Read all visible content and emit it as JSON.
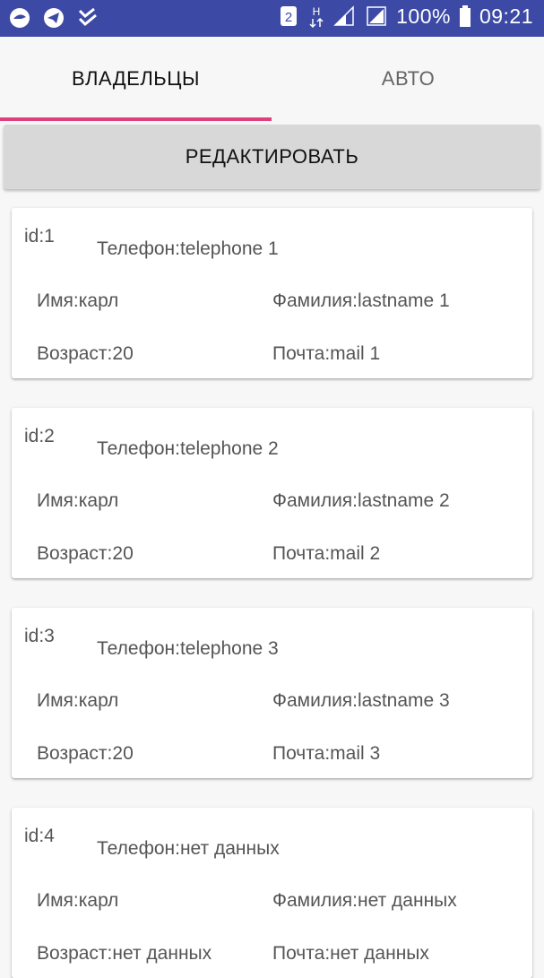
{
  "status": {
    "battery": "100%",
    "time": "09:21",
    "sim_badge": "2",
    "net_label": "H",
    "icons": [
      "app-icon",
      "telegram-icon",
      "checklist-icon",
      "sim-icon",
      "network-type-icon",
      "signal-icon",
      "signal-icon",
      "battery-icon"
    ]
  },
  "tabs": [
    {
      "label": "ВЛАДЕЛЬЦЫ",
      "active": true
    },
    {
      "label": "АВТО",
      "active": false
    }
  ],
  "accent": "#e0407a",
  "statusbar_color": "#3c4aa6",
  "edit_button": {
    "label": "РЕДАКТИРОВАТЬ"
  },
  "cards": [
    {
      "id": "id:1",
      "phone": "Телефон:telephone 1",
      "name": "Имя:карл",
      "lastname": "Фамилия:lastname 1",
      "age": "Возраст:20",
      "mail": "Почта:mail 1"
    },
    {
      "id": "id:2",
      "phone": "Телефон:telephone 2",
      "name": "Имя:карл",
      "lastname": "Фамилия:lastname 2",
      "age": "Возраст:20",
      "mail": "Почта:mail 2"
    },
    {
      "id": "id:3",
      "phone": "Телефон:telephone 3",
      "name": "Имя:карл",
      "lastname": "Фамилия:lastname 3",
      "age": "Возраст:20",
      "mail": "Почта:mail 3"
    },
    {
      "id": "id:4",
      "phone": "Телефон:нет данных",
      "name": "Имя:карл",
      "lastname": "Фамилия:нет данных",
      "age": "Возраст:нет данных",
      "mail": "Почта:нет данных"
    }
  ]
}
